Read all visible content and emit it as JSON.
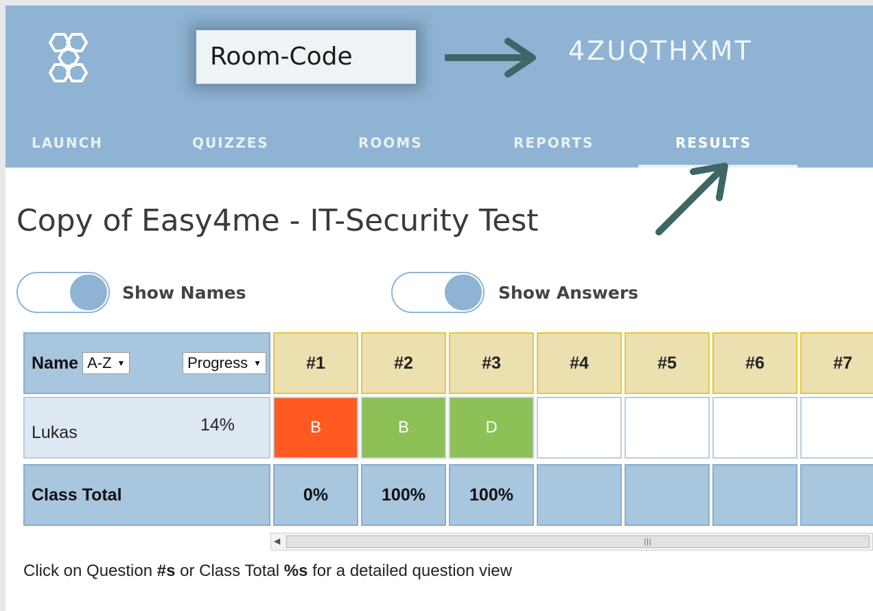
{
  "header": {
    "room_code_label": "Room-Code",
    "room_code_value": "4ZUQTHXMT",
    "nav": [
      {
        "label": "LAUNCH",
        "active": false
      },
      {
        "label": "QUIZZES",
        "active": false
      },
      {
        "label": "ROOMS",
        "active": false
      },
      {
        "label": "REPORTS",
        "active": false
      },
      {
        "label": "RESULTS",
        "active": true
      }
    ]
  },
  "page_title": "Copy of Easy4me - IT-Security Test",
  "toggles": {
    "show_names": {
      "label": "Show Names",
      "on": true
    },
    "show_answers": {
      "label": "Show Answers",
      "on": true
    }
  },
  "table": {
    "name_header": "Name",
    "sort_select": "A-Z",
    "progress_select": "Progress",
    "questions": [
      "#1",
      "#2",
      "#3",
      "#4",
      "#5",
      "#6",
      "#7"
    ],
    "students": [
      {
        "name": "Lukas",
        "progress": "14%",
        "answers": [
          {
            "value": "B",
            "status": "wrong"
          },
          {
            "value": "B",
            "status": "correct"
          },
          {
            "value": "D",
            "status": "correct"
          },
          {
            "value": "",
            "status": "none"
          },
          {
            "value": "",
            "status": "none"
          },
          {
            "value": "",
            "status": "none"
          },
          {
            "value": "",
            "status": "none"
          }
        ]
      }
    ],
    "class_total_label": "Class Total",
    "class_totals": [
      "0%",
      "100%",
      "100%",
      "",
      "",
      "",
      ""
    ]
  },
  "colors": {
    "header_bg": "#8fb3d3",
    "wrong": "#ff5a22",
    "correct": "#8dc056",
    "question_header": "#ecdfb0",
    "annotation_arrow": "#3d6767"
  },
  "hint": {
    "prefix": "Click on Question ",
    "q_bold": "#s",
    "middle": " or Class Total ",
    "t_bold": "%s",
    "suffix": " for a detailed question view"
  }
}
